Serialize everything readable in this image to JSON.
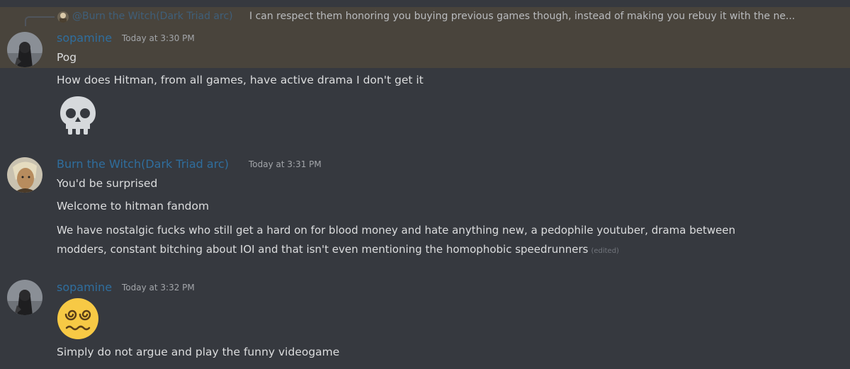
{
  "reply": {
    "mention": "@Burn the Witch(Dark Triad arc)",
    "text": "I can respect them honoring you buying previous games though, instead of making you rebuy it with the ne..."
  },
  "messages": [
    {
      "author": "sopamine",
      "timestamp": "Today at 3:30 PM",
      "lines": [
        "Pog",
        "How does Hitman, from all games, have active drama I don't get it"
      ],
      "emoji": "skull-emoji"
    },
    {
      "author": "Burn the Witch(Dark Triad arc)",
      "timestamp": "Today at 3:31 PM",
      "lines": [
        "You'd be surprised",
        "Welcome to hitman fandom",
        "We have nostalgic fucks who still get a hard on for blood money and hate anything new, a pedophile youtuber, drama between",
        "modders, constant bitching about IOI and that isn't even mentioning the homophobic speedrunners"
      ],
      "edited": "(edited)"
    },
    {
      "author": "sopamine",
      "timestamp": "Today at 3:32 PM",
      "emoji": "dizzy-face-emoji",
      "lines": [
        "Simply do not argue and play the funny videogame"
      ]
    }
  ],
  "colors": {
    "background": "#36393f",
    "highlight": "#49443c",
    "username": "#2f6e9e",
    "text": "#dcddde",
    "muted": "#a3a6aa"
  }
}
